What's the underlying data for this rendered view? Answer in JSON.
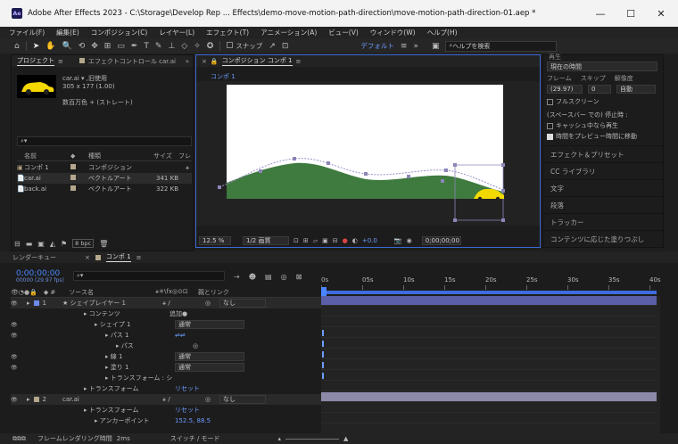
{
  "window": {
    "title": "Adobe After Effects 2023 - C:\\Storage\\Develop Rep ... Effects\\demo-move-motion-path-direction\\move-motion-path-direction-01.aep *",
    "app_icon": "Ae"
  },
  "menu": [
    "ファイル(F)",
    "編集(E)",
    "コンポジション(C)",
    "レイヤー(L)",
    "エフェクト(T)",
    "アニメーション(A)",
    "ビュー(V)",
    "ウィンドウ(W)",
    "ヘルプ(H)"
  ],
  "toolbar": {
    "snap_label": "スナップ",
    "workspace": "デフォルト",
    "search_placeholder": "ヘルプを検索"
  },
  "project": {
    "tab_label": "プロジェクト",
    "effect_tab": "エフェクトコントロール car.ai",
    "item_name": "car.ai ▾ ,旧使用",
    "item_size": "305 x 177 (1.00)",
    "item_color": "数百万色 + (ストレート)",
    "cols": {
      "name": "名前",
      "type": "種類",
      "size": "サイズ",
      "frame": "フレ"
    },
    "items": [
      {
        "name": "コンポ 1",
        "type": "コンポジション",
        "size": "",
        "color": "#b4a78c"
      },
      {
        "name": "car.ai",
        "type": "ベクトルアート",
        "size": "341 KB",
        "color": "#b4a78c"
      },
      {
        "name": "back.ai",
        "type": "ベクトルアート",
        "size": "322 KB",
        "color": "#b4a78c"
      }
    ],
    "bpc": "8 bpc"
  },
  "comp": {
    "tab_label": "コンポジション コンポ 1",
    "sub_tab": "コンポ 1",
    "zoom": "12.5 %",
    "quality": "1/2 画質",
    "exposure": "+0.0",
    "time": "0;00;00;00"
  },
  "right": {
    "header": "再生",
    "current_time": "現在の時間",
    "frame_label": "フレーム",
    "skip_label": "スキップ",
    "res_label": "解像度",
    "frame_val": "(29.97)",
    "skip_val": "0",
    "res_val": "自動",
    "fullscreen": "フルスクリーン",
    "stop_label": "(スペースバー での) 停止時 :",
    "cache_label": "キャッシュ中なら再生",
    "preview_label": "時間をプレビュー時間に移動",
    "panels": [
      "エフェクト＆プリセット",
      "CC ライブラリ",
      "文字",
      "段落",
      "トラッカー",
      "コンテンツに応じた塗りつぶし"
    ]
  },
  "timeline": {
    "render_tab": "レンダーキュー",
    "comp_tab": "コンポ 1",
    "timecode": "0;00;00;00",
    "fps": "00000 (29.97 fps)",
    "col_source": "ソース名",
    "col_parent": "親とリンク",
    "add": "追加",
    "reset": "リセット",
    "none": "なし",
    "ruler": [
      "0s",
      "05s",
      "10s",
      "15s",
      "20s",
      "25s",
      "30s",
      "35s",
      "40s"
    ],
    "rows": [
      {
        "indent": 0,
        "num": "1",
        "name": "★ シェイプレイヤー 1",
        "mode": "",
        "parent": "なし",
        "layer": true
      },
      {
        "indent": 1,
        "num": "",
        "name": "コンテンツ",
        "mode": "",
        "parent": "",
        "layer": false
      },
      {
        "indent": 2,
        "num": "",
        "name": "シェイプ 1",
        "mode": "通常",
        "parent": "",
        "layer": false
      },
      {
        "indent": 3,
        "num": "",
        "name": "パス 1",
        "mode": "⇌⇌",
        "parent": "",
        "layer": false
      },
      {
        "indent": 4,
        "num": "",
        "name": "パス",
        "mode": "",
        "parent": "",
        "layer": false
      },
      {
        "indent": 3,
        "num": "",
        "name": "線 1",
        "mode": "通常",
        "parent": "",
        "layer": false
      },
      {
        "indent": 3,
        "num": "",
        "name": "塗り 1",
        "mode": "通常",
        "parent": "",
        "layer": false
      },
      {
        "indent": 3,
        "num": "",
        "name": "トランスフォーム : シ 1",
        "mode": "",
        "parent": "",
        "layer": false
      },
      {
        "indent": 1,
        "num": "",
        "name": "トランスフォーム",
        "mode": "リセット",
        "parent": "",
        "layer": false
      },
      {
        "indent": 0,
        "num": "2",
        "name": "car.ai",
        "mode": "",
        "parent": "なし",
        "layer": true
      },
      {
        "indent": 1,
        "num": "",
        "name": "トランスフォーム",
        "mode": "リセット",
        "parent": "",
        "layer": false
      },
      {
        "indent": 2,
        "num": "",
        "name": "アンカーポイント",
        "mode": "152.5, 88.5",
        "parent": "",
        "layer": false
      }
    ],
    "footer": "フレームレンダリング時間",
    "footer_val": "2ms",
    "switch_mode": "スイッチ / モード"
  }
}
